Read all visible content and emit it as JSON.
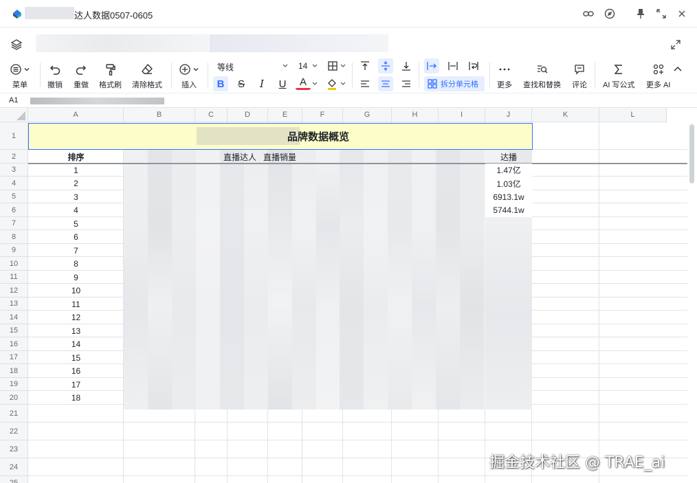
{
  "window": {
    "title": "达人数据0507-0605"
  },
  "toolbar": {
    "menu": "菜单",
    "undo": "撤销",
    "redo": "重做",
    "format_painter": "格式刷",
    "clear_format": "清除格式",
    "insert": "插入",
    "font_name": "等线",
    "font_size": "14",
    "split_cells": "拆分单元格",
    "more": "更多",
    "find_replace": "查找和替换",
    "comment": "评论",
    "ai_formula": "AI 写公式",
    "more_ai": "更多 AI"
  },
  "formula_bar": {
    "cell_ref": "A1"
  },
  "sheet": {
    "columns": [
      "A",
      "B",
      "C",
      "D",
      "E",
      "F",
      "G",
      "H",
      "I",
      "J",
      "K",
      "L"
    ],
    "rows": [
      "1",
      "2",
      "3",
      "4",
      "5",
      "6",
      "7",
      "8",
      "9",
      "10",
      "11",
      "12",
      "13",
      "14",
      "15",
      "16",
      "17",
      "18",
      "19",
      "20",
      "21",
      "22",
      "23",
      "24",
      "25"
    ],
    "title_cell": "品牌数据概览",
    "header_rank": "排序",
    "header_streamer": "直播达人",
    "header_sales": "直播销量",
    "header_reach": "达播",
    "ranks": [
      "1",
      "2",
      "3",
      "4",
      "5",
      "6",
      "7",
      "8",
      "9",
      "10",
      "11",
      "12",
      "13",
      "14",
      "15",
      "16",
      "17",
      "18"
    ],
    "reach_values": [
      "1.47亿",
      "1.03亿",
      "6913.1w",
      "5744.1w"
    ]
  },
  "watermark": "掘金技术社区 @ TRAE_ai",
  "colors": {
    "accent": "#3370ff",
    "title_fill": "#fdfdc9",
    "grid_line": "#e1e3e6",
    "header_bg": "#f5f6f7"
  }
}
